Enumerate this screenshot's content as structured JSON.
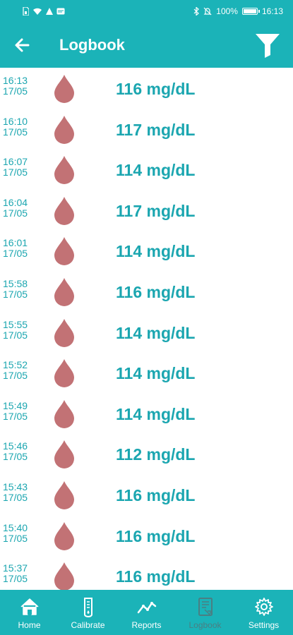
{
  "status_bar": {
    "left_icons": [
      "sim-icon",
      "wifi-icon",
      "notification-icon",
      "message-icon"
    ],
    "right_icons": [
      "bluetooth-icon",
      "mute-icon"
    ],
    "battery_text": "100%",
    "battery_level": 1.0,
    "time": "16:13"
  },
  "app_bar": {
    "title": "Logbook",
    "back_icon": "arrow-left-icon",
    "filter_icon": "filter-icon"
  },
  "entries": [
    {
      "time": "16:13",
      "date": "17/05",
      "value": "116 mg/dL"
    },
    {
      "time": "16:10",
      "date": "17/05",
      "value": "117 mg/dL"
    },
    {
      "time": "16:07",
      "date": "17/05",
      "value": "114 mg/dL"
    },
    {
      "time": "16:04",
      "date": "17/05",
      "value": "117 mg/dL"
    },
    {
      "time": "16:01",
      "date": "17/05",
      "value": "114 mg/dL"
    },
    {
      "time": "15:58",
      "date": "17/05",
      "value": "116 mg/dL"
    },
    {
      "time": "15:55",
      "date": "17/05",
      "value": "114 mg/dL"
    },
    {
      "time": "15:52",
      "date": "17/05",
      "value": "114 mg/dL"
    },
    {
      "time": "15:49",
      "date": "17/05",
      "value": "114 mg/dL"
    },
    {
      "time": "15:46",
      "date": "17/05",
      "value": "112 mg/dL"
    },
    {
      "time": "15:43",
      "date": "17/05",
      "value": "116 mg/dL"
    },
    {
      "time": "15:40",
      "date": "17/05",
      "value": "116 mg/dL"
    },
    {
      "time": "15:37",
      "date": "17/05",
      "value": "116 mg/dL"
    }
  ],
  "colors": {
    "primary": "#1bb3b8",
    "value_text": "#1ba6b0",
    "drop": "#c27275",
    "active_nav": "#4a7f83"
  },
  "bottom_nav": [
    {
      "label": "Home",
      "icon": "home-icon",
      "active": false
    },
    {
      "label": "Calibrate",
      "icon": "calibrate-icon",
      "active": false
    },
    {
      "label": "Reports",
      "icon": "reports-icon",
      "active": false
    },
    {
      "label": "Logbook",
      "icon": "logbook-icon",
      "active": true
    },
    {
      "label": "Settings",
      "icon": "gear-icon",
      "active": false
    }
  ]
}
